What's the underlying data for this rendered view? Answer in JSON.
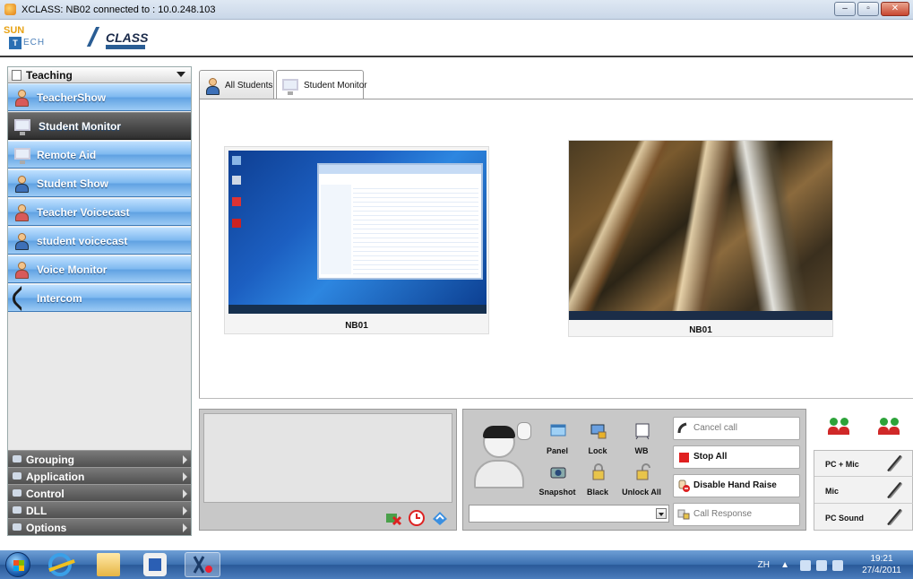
{
  "window": {
    "title": "XCLASS: NB02 connected to : 10.0.248.103",
    "controls": [
      "minimize",
      "maximize",
      "close"
    ]
  },
  "logos": {
    "suntech_top": "SUN",
    "suntech_box": "T",
    "suntech_rest": "ECH",
    "xclass": "CLASS"
  },
  "sidebar": {
    "header": "Teaching",
    "items": [
      {
        "label": "TeacherShow",
        "icon": "teacher-show-icon"
      },
      {
        "label": "Student Monitor",
        "icon": "monitor-icon",
        "active": true
      },
      {
        "label": "Remote Aid",
        "icon": "remote-aid-icon"
      },
      {
        "label": "Student Show",
        "icon": "student-show-icon"
      },
      {
        "label": "Teacher Voicecast",
        "icon": "teacher-voicecast-icon"
      },
      {
        "label": "student voicecast",
        "icon": "student-voicecast-icon"
      },
      {
        "label": "Voice Monitor",
        "icon": "voice-monitor-icon"
      },
      {
        "label": "Intercom",
        "icon": "phone-icon"
      }
    ],
    "bottom": [
      "Grouping",
      "Application",
      "Control",
      "DLL",
      "Options"
    ]
  },
  "tabs": [
    {
      "label": "All Students"
    },
    {
      "label": "Student Monitor",
      "active": true
    }
  ],
  "thumbnails": [
    {
      "caption": "NB01"
    },
    {
      "caption": "NB01"
    }
  ],
  "tools": {
    "panel": "Panel",
    "lock": "Lock",
    "wb": "WB",
    "snapshot": "Snapshot",
    "black": "Black",
    "unlock_all": "Unlock All"
  },
  "actions": {
    "cancel_call": "Cancel call",
    "stop_all": "Stop All",
    "disable_hand_raise": "Disable Hand Raise",
    "call_response": "Call Response"
  },
  "audio": {
    "pc_mic": "PC + Mic",
    "mic": "Mic",
    "pc_sound": "PC Sound"
  },
  "taskbar": {
    "lang": "ZH",
    "time": "19:21",
    "date": "27/4/2011"
  },
  "colors": {
    "nav_blue": "#5fa1e2",
    "nav_active": "#2e2e2e",
    "stop_red": "#e02020",
    "taskbar": "#3b6fb0"
  }
}
